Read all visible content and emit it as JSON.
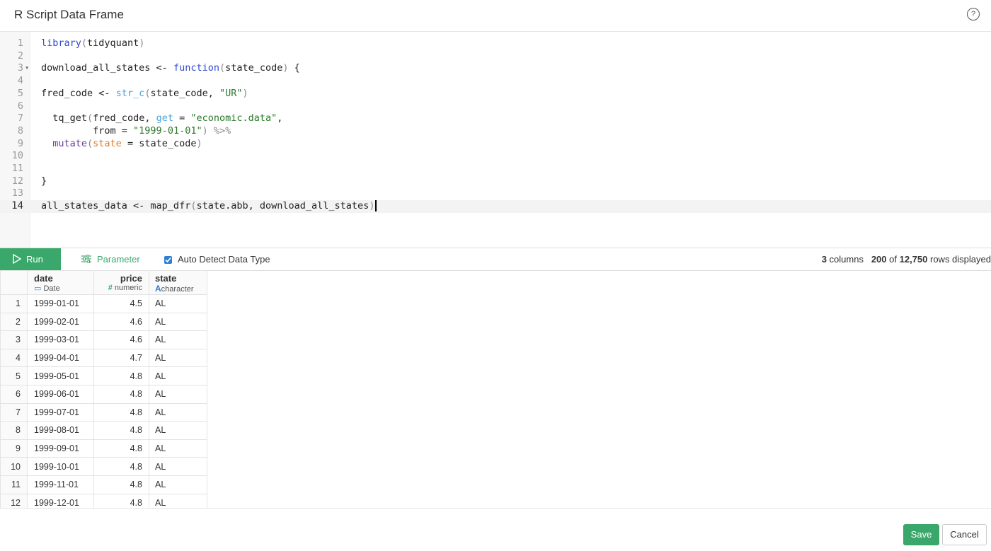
{
  "header": {
    "title": "R Script Data Frame",
    "help_icon": "?"
  },
  "editor": {
    "lines": [
      {
        "n": "1"
      },
      {
        "n": "2"
      },
      {
        "n": "3"
      },
      {
        "n": "4"
      },
      {
        "n": "5"
      },
      {
        "n": "6"
      },
      {
        "n": "7"
      },
      {
        "n": "8"
      },
      {
        "n": "9"
      },
      {
        "n": "10"
      },
      {
        "n": "11"
      },
      {
        "n": "12"
      },
      {
        "n": "13"
      },
      {
        "n": "14"
      }
    ],
    "code": {
      "l1_a": "library",
      "l1_b": "(",
      "l1_c": "tidyquant",
      "l1_d": ")",
      "l3_a": "download_all_states <- ",
      "l3_b": "function",
      "l3_c": "(",
      "l3_d": "state_code",
      "l3_e": ")",
      "l3_f": " {",
      "l5_a": "fred_code <- ",
      "l5_b": "str_c",
      "l5_c": "(",
      "l5_d": "state_code, ",
      "l5_e": "\"UR\"",
      "l5_f": ")",
      "l7_a": "  tq_get",
      "l7_b": "(",
      "l7_c": "fred_code, ",
      "l7_d": "get",
      "l7_e": " = ",
      "l7_f": "\"economic.data\"",
      "l7_g": ",",
      "l8_a": "         from = ",
      "l8_b": "\"1999-01-01\"",
      "l8_c": ")",
      "l8_d": " %>%",
      "l9_a": "  mutate",
      "l9_b": "(",
      "l9_c": "state",
      "l9_d": " = state_code",
      "l9_e": ")",
      "l12_a": "}",
      "l14_a": "all_states_data <- map_dfr",
      "l14_b": "(",
      "l14_c": "state.abb, download_all_states",
      "l14_d": ")"
    }
  },
  "toolbar": {
    "run_label": "Run",
    "parameter_label": "Parameter",
    "auto_detect_label": "Auto Detect Data Type",
    "auto_detect_checked": true,
    "stats": {
      "columns": "3",
      "columns_label": "columns",
      "shown": "200",
      "of": "of",
      "total": "12,750",
      "suffix": "rows displayed"
    }
  },
  "table": {
    "columns": [
      {
        "name": "date",
        "type": "Date"
      },
      {
        "name": "price",
        "type": "numeric"
      },
      {
        "name": "state",
        "type": "character"
      }
    ],
    "rows": [
      {
        "n": "1",
        "date": "1999-01-01",
        "price": "4.5",
        "state": "AL"
      },
      {
        "n": "2",
        "date": "1999-02-01",
        "price": "4.6",
        "state": "AL"
      },
      {
        "n": "3",
        "date": "1999-03-01",
        "price": "4.6",
        "state": "AL"
      },
      {
        "n": "4",
        "date": "1999-04-01",
        "price": "4.7",
        "state": "AL"
      },
      {
        "n": "5",
        "date": "1999-05-01",
        "price": "4.8",
        "state": "AL"
      },
      {
        "n": "6",
        "date": "1999-06-01",
        "price": "4.8",
        "state": "AL"
      },
      {
        "n": "7",
        "date": "1999-07-01",
        "price": "4.8",
        "state": "AL"
      },
      {
        "n": "8",
        "date": "1999-08-01",
        "price": "4.8",
        "state": "AL"
      },
      {
        "n": "9",
        "date": "1999-09-01",
        "price": "4.8",
        "state": "AL"
      },
      {
        "n": "10",
        "date": "1999-10-01",
        "price": "4.8",
        "state": "AL"
      },
      {
        "n": "11",
        "date": "1999-11-01",
        "price": "4.8",
        "state": "AL"
      },
      {
        "n": "12",
        "date": "1999-12-01",
        "price": "4.8",
        "state": "AL"
      }
    ]
  },
  "footer": {
    "save_label": "Save",
    "cancel_label": "Cancel"
  },
  "colors": {
    "accent": "#3aa86b",
    "checkbox": "#2d7fd3"
  }
}
